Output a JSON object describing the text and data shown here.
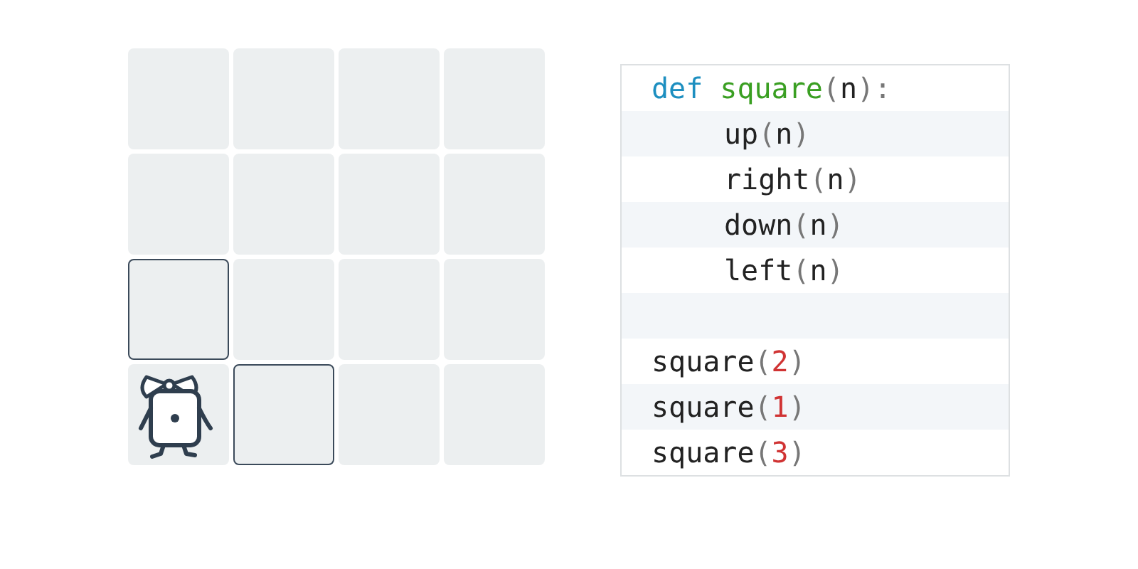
{
  "grid": {
    "rows": [
      [
        {
          "outlined": false,
          "has_character": false
        },
        {
          "outlined": false,
          "has_character": false
        },
        {
          "outlined": false,
          "has_character": false
        },
        {
          "outlined": false,
          "has_character": false
        }
      ],
      [
        {
          "outlined": false,
          "has_character": false
        },
        {
          "outlined": false,
          "has_character": false
        },
        {
          "outlined": false,
          "has_character": false
        },
        {
          "outlined": false,
          "has_character": false
        }
      ],
      [
        {
          "outlined": true,
          "has_character": false
        },
        {
          "outlined": false,
          "has_character": false
        },
        {
          "outlined": false,
          "has_character": false
        },
        {
          "outlined": false,
          "has_character": false
        }
      ],
      [
        {
          "outlined": false,
          "has_character": true
        },
        {
          "outlined": true,
          "has_character": false
        },
        {
          "outlined": false,
          "has_character": false
        },
        {
          "outlined": false,
          "has_character": false
        }
      ]
    ]
  },
  "code": {
    "lines": [
      {
        "kind": "code",
        "indent": false,
        "tokens": [
          {
            "text": "def",
            "kind": "keyword"
          },
          {
            "text": "square",
            "kind": "function"
          },
          {
            "text": "(",
            "kind": "punct"
          },
          {
            "text": "n",
            "kind": "plain"
          },
          {
            "text": "):",
            "kind": "punct"
          }
        ]
      },
      {
        "kind": "code",
        "indent": true,
        "tokens": [
          {
            "text": "up",
            "kind": "plain"
          },
          {
            "text": "(",
            "kind": "punct"
          },
          {
            "text": "n",
            "kind": "plain"
          },
          {
            "text": ")",
            "kind": "punct"
          }
        ]
      },
      {
        "kind": "code",
        "indent": true,
        "tokens": [
          {
            "text": "right",
            "kind": "plain"
          },
          {
            "text": "(",
            "kind": "punct"
          },
          {
            "text": "n",
            "kind": "plain"
          },
          {
            "text": ")",
            "kind": "punct"
          }
        ]
      },
      {
        "kind": "code",
        "indent": true,
        "tokens": [
          {
            "text": "down",
            "kind": "plain"
          },
          {
            "text": "(",
            "kind": "punct"
          },
          {
            "text": "n",
            "kind": "plain"
          },
          {
            "text": ")",
            "kind": "punct"
          }
        ]
      },
      {
        "kind": "code",
        "indent": true,
        "tokens": [
          {
            "text": "left",
            "kind": "plain"
          },
          {
            "text": "(",
            "kind": "punct"
          },
          {
            "text": "n",
            "kind": "plain"
          },
          {
            "text": ")",
            "kind": "punct"
          }
        ]
      },
      {
        "kind": "blank"
      },
      {
        "kind": "code",
        "indent": false,
        "tokens": [
          {
            "text": "square",
            "kind": "plain"
          },
          {
            "text": "(",
            "kind": "punct"
          },
          {
            "text": "2",
            "kind": "number"
          },
          {
            "text": ")",
            "kind": "punct"
          }
        ]
      },
      {
        "kind": "code",
        "indent": false,
        "tokens": [
          {
            "text": "square",
            "kind": "plain"
          },
          {
            "text": "(",
            "kind": "punct"
          },
          {
            "text": "1",
            "kind": "number"
          },
          {
            "text": ")",
            "kind": "punct"
          }
        ]
      },
      {
        "kind": "code",
        "indent": false,
        "tokens": [
          {
            "text": "square",
            "kind": "plain"
          },
          {
            "text": "(",
            "kind": "punct"
          },
          {
            "text": "3",
            "kind": "number"
          },
          {
            "text": ")",
            "kind": "punct"
          }
        ]
      }
    ]
  }
}
